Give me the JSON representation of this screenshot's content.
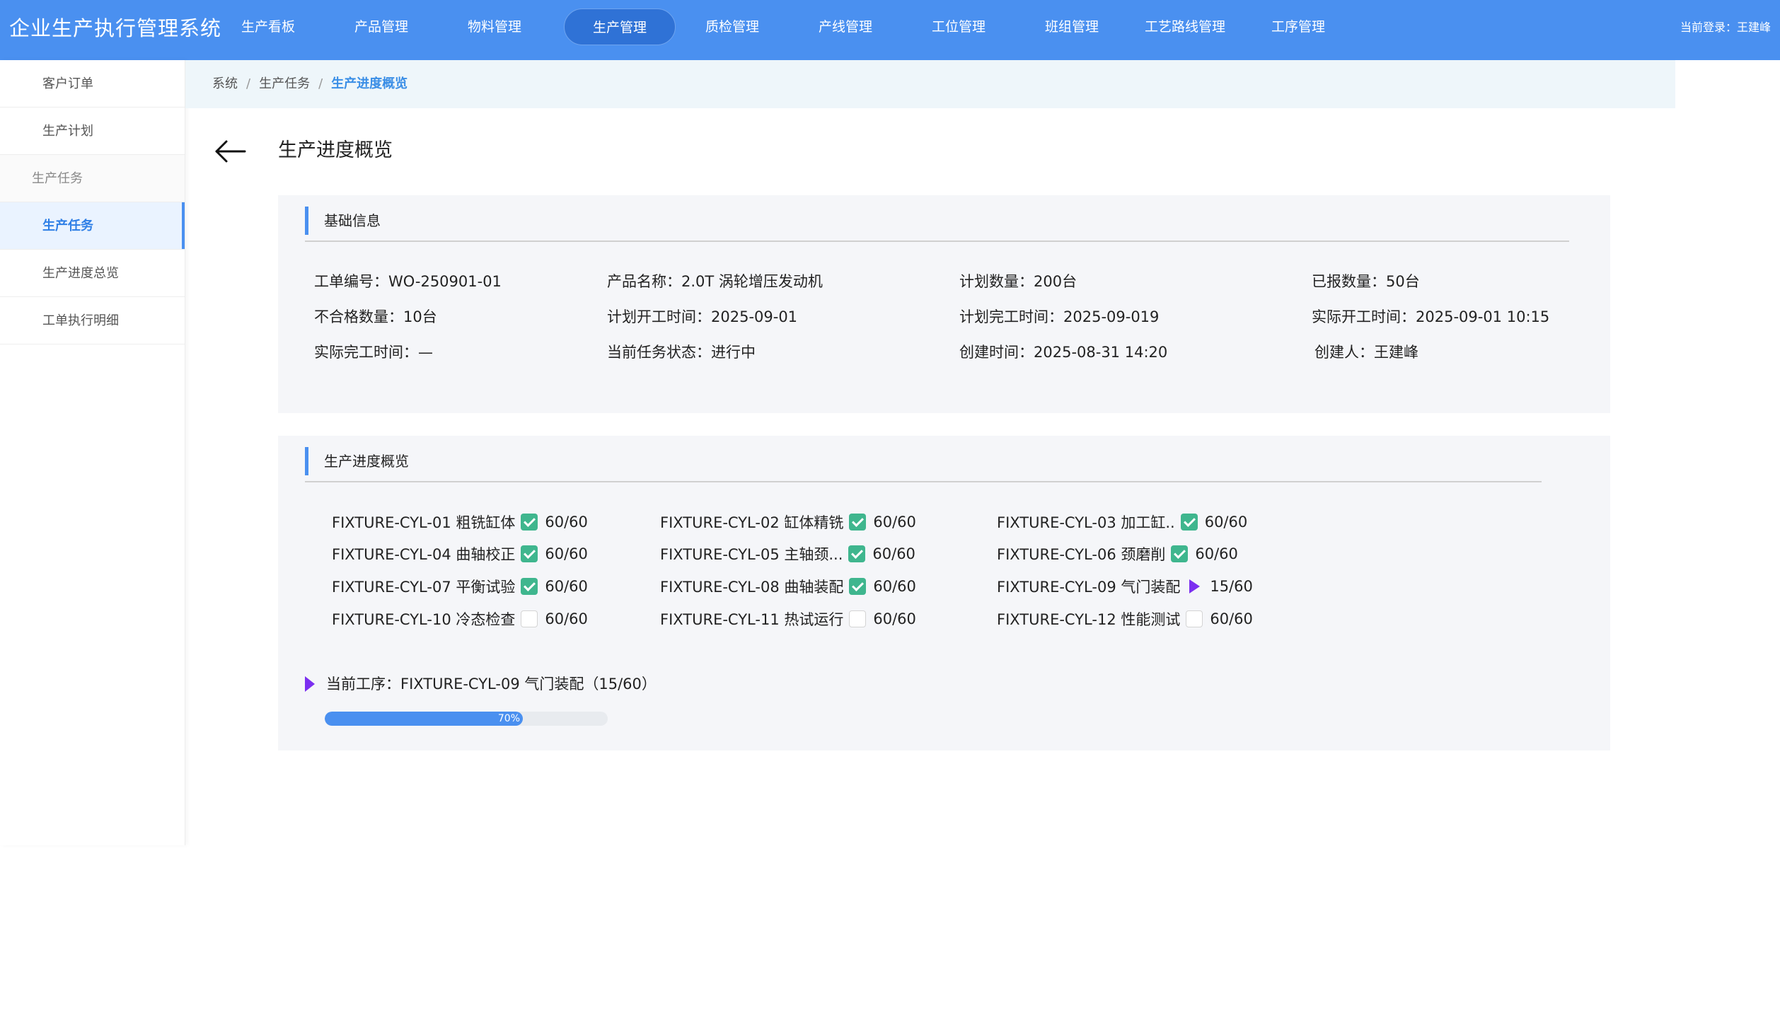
{
  "app": {
    "title": "企业生产执行管理系统",
    "login_info": "当前登录：王建峰"
  },
  "nav": {
    "items": [
      {
        "label": "生产看板",
        "active": false
      },
      {
        "label": "产品管理",
        "active": false
      },
      {
        "label": "物料管理",
        "active": false
      },
      {
        "label": "生产管理",
        "active": true
      },
      {
        "label": "质检管理",
        "active": false
      },
      {
        "label": "产线管理",
        "active": false
      },
      {
        "label": "工位管理",
        "active": false
      },
      {
        "label": "班组管理",
        "active": false
      },
      {
        "label": "工艺路线管理",
        "active": false
      },
      {
        "label": "工序管理",
        "active": false
      }
    ]
  },
  "sidebar": {
    "items": [
      {
        "label": "客户订单",
        "type": "item"
      },
      {
        "label": "生产计划",
        "type": "item"
      },
      {
        "label": "生产任务",
        "type": "group"
      },
      {
        "label": "生产任务",
        "type": "active"
      },
      {
        "label": "生产进度总览",
        "type": "item"
      },
      {
        "label": "工单执行明细",
        "type": "item"
      }
    ]
  },
  "breadcrumb": {
    "items": [
      "系统",
      "生产任务"
    ],
    "separator": "/",
    "current": "生产进度概览"
  },
  "page": {
    "title": "生产进度概览"
  },
  "basic_info": {
    "title": "基础信息",
    "fields": [
      "工单编号：WO-250901-01",
      "产品名称：2.0T 涡轮增压发动机",
      "计划数量：200台",
      "已报数量：50台",
      "不合格数量：10台",
      "计划开工时间：2025-09-01",
      "计划完工时间：2025-09-019",
      "实际开工时间：2025-09-01 10:15",
      "实际完工时间：—",
      "当前任务状态：进行中",
      "创建时间：2025-08-31 14:20",
      "创建人：王建峰"
    ]
  },
  "progress": {
    "title": "生产进度概览",
    "processes": [
      {
        "name": "FIXTURE-CYL-01 粗铣缸体",
        "status": "done",
        "count": "60/60"
      },
      {
        "name": "FIXTURE-CYL-02 缸体精铣",
        "status": "done",
        "count": "60/60"
      },
      {
        "name": "FIXTURE-CYL-03 加工缸..",
        "status": "done",
        "count": "60/60"
      },
      {
        "name": "FIXTURE-CYL-04 曲轴校正",
        "status": "done",
        "count": "60/60"
      },
      {
        "name": "FIXTURE-CYL-05 主轴颈...",
        "status": "done",
        "count": "60/60"
      },
      {
        "name": "FIXTURE-CYL-06 颈磨削",
        "status": "done",
        "count": "60/60"
      },
      {
        "name": "FIXTURE-CYL-07 平衡试验",
        "status": "done",
        "count": "60/60"
      },
      {
        "name": "FIXTURE-CYL-08 曲轴装配",
        "status": "done",
        "count": "60/60"
      },
      {
        "name": "FIXTURE-CYL-09 气门装配",
        "status": "running",
        "count": "15/60"
      },
      {
        "name": "FIXTURE-CYL-10 冷态检查",
        "status": "todo",
        "count": "60/60"
      },
      {
        "name": "FIXTURE-CYL-11 热试运行",
        "status": "todo",
        "count": "60/60"
      },
      {
        "name": "FIXTURE-CYL-12 性能测试",
        "status": "todo",
        "count": "60/60"
      }
    ],
    "current_step": "当前工序：FIXTURE-CYL-09 气门装配（15/60）",
    "percent_label": "70%",
    "percent": 70
  },
  "colors": {
    "nav_bg": "#4a90f0",
    "accent": "#3a8ee6",
    "done": "#3fb68e",
    "running": "#7b2ff0"
  },
  "icons": {
    "back": "arrow-left-icon",
    "done": "check-icon",
    "running": "play-icon",
    "todo": "empty-box-icon"
  }
}
